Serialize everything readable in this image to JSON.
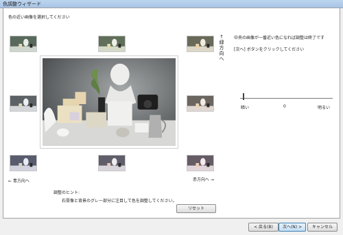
{
  "window": {
    "title": "色調整ウィザード"
  },
  "instruction": "色の近い画像を選択してください",
  "right_panel": {
    "message": "中央の画像が一番近い色になれば調整は終了です",
    "next_hint": "[次へ] ボタンをクリックしてください",
    "vertical_label": "↑ 緑方向へ"
  },
  "slider": {
    "label_dark": "暗い",
    "label_mid": "0",
    "label_bright": "明るい",
    "value_fraction": 0.03
  },
  "direction_labels": {
    "blue": "← 青方向へ",
    "red": "赤方向へ →"
  },
  "hint": {
    "title": "調整のヒント:",
    "body": "石膏像と背景のグレー部分に注目して色を調整してください。"
  },
  "buttons": {
    "reset": "リセット",
    "back": "< 戻る(B)",
    "next": "次へ(N) >",
    "cancel": "キャンセル"
  }
}
